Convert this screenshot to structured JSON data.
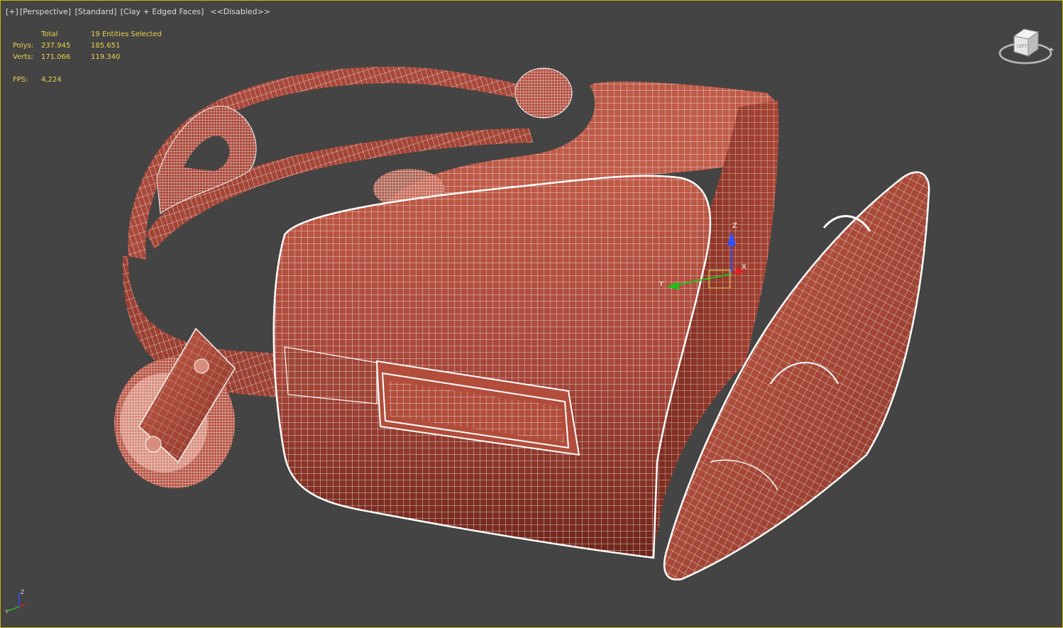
{
  "viewport": {
    "plus": "[+]",
    "view": "[Perspective]",
    "shading_preset": "[Standard]",
    "visual_style": "[Clay + Edged Faces]",
    "state": "<<Disabled>>"
  },
  "stats": {
    "header": {
      "label": "",
      "total": "Total",
      "selected": "19 Entities Selected"
    },
    "polys": {
      "label": "Polys:",
      "total": "237.945",
      "selected": "185.651"
    },
    "verts": {
      "label": "Verts:",
      "total": "171.066",
      "selected": "119.340"
    },
    "fps": {
      "label": "FPS:",
      "value": "4,224"
    }
  },
  "viewcube": {
    "face_label": "LEFT",
    "icon": "viewcube-icon"
  },
  "gizmo": {
    "x": "X",
    "y": "Y",
    "z": "Z"
  },
  "colors": {
    "viewport_bg": "#444444",
    "active_border": "#c8b400",
    "stats_text": "#e8d44d",
    "clay": "#b0503e",
    "clay_dark": "#7a2a1e",
    "wire": "#f2f2f2",
    "axis_x": "#e02020",
    "axis_y": "#20c020",
    "axis_z": "#3050ff"
  }
}
